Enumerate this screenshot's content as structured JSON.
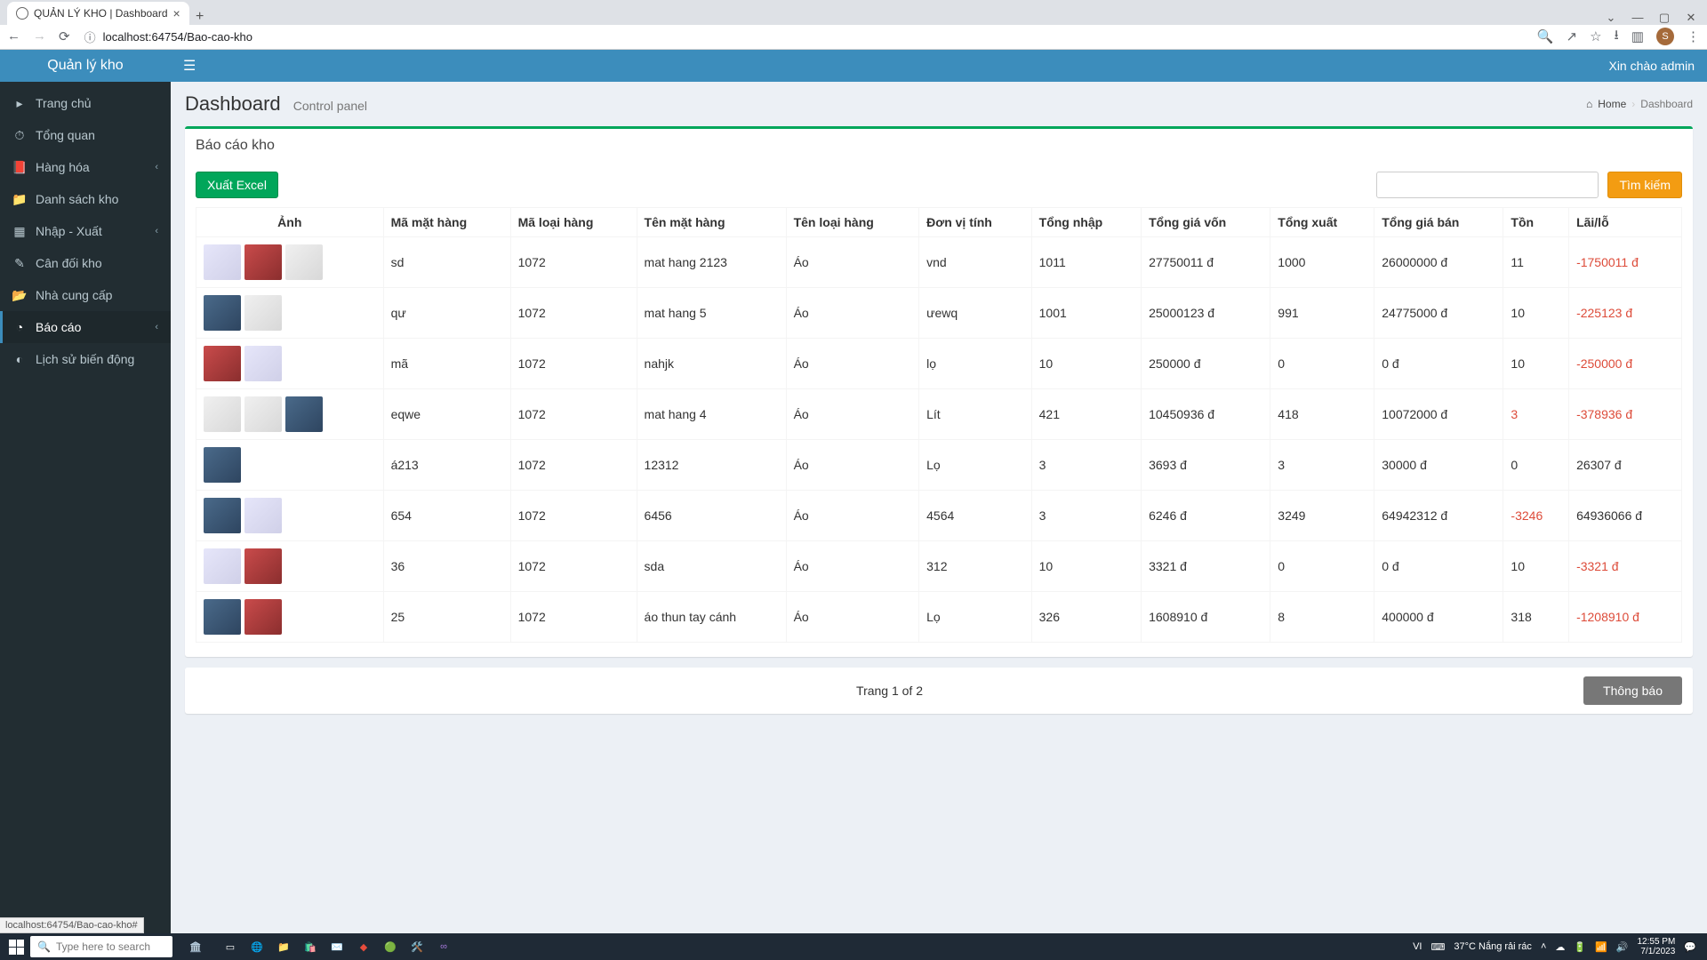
{
  "browser": {
    "tab_title": "QUẢN LÝ KHO | Dashboard",
    "url_info": "localhost:64754/Bao-cao-kho",
    "avatar_letter": "S"
  },
  "app": {
    "brand": "Quản lý kho",
    "greeting": "Xin chào admin"
  },
  "sidebar": {
    "items": [
      {
        "label": "Trang chủ",
        "has_sub": false,
        "active": false
      },
      {
        "label": "Tổng quan",
        "has_sub": false,
        "active": false
      },
      {
        "label": "Hàng hóa",
        "has_sub": true,
        "active": false
      },
      {
        "label": "Danh sách kho",
        "has_sub": false,
        "active": false
      },
      {
        "label": "Nhập - Xuất",
        "has_sub": true,
        "active": false
      },
      {
        "label": "Cân đối kho",
        "has_sub": false,
        "active": false
      },
      {
        "label": "Nhà cung cấp",
        "has_sub": false,
        "active": false
      },
      {
        "label": "Báo cáo",
        "has_sub": true,
        "active": true
      },
      {
        "label": "Lịch sử biến động",
        "has_sub": false,
        "active": false
      }
    ]
  },
  "header": {
    "title": "Dashboard",
    "subtitle": "Control panel",
    "breadcrumb_home": "Home",
    "breadcrumb_current": "Dashboard"
  },
  "box": {
    "title": "Báo cáo kho",
    "export_label": "Xuất Excel",
    "search_label": "Tìm kiếm"
  },
  "table": {
    "columns": [
      "Ảnh",
      "Mã mặt hàng",
      "Mã loại hàng",
      "Tên mặt hàng",
      "Tên loại hàng",
      "Đơn vị tính",
      "Tổng nhập",
      "Tổng giá vốn",
      "Tổng xuất",
      "Tổng giá bán",
      "Tồn",
      "Lãi/lỗ"
    ],
    "rows": [
      {
        "thumbs": [
          "p1",
          "p2",
          "p3"
        ],
        "ma_mh": "sd",
        "ma_lh": "1072",
        "ten_mh": "mat hang 2123",
        "ten_lh": "Áo",
        "dvt": "vnd",
        "tong_nhap": "1011",
        "gia_von": "27750011 đ",
        "tong_xuat": "1000",
        "gia_ban": "26000000 đ",
        "ton": "11",
        "ton_neg": false,
        "laiLo": "-1750011 đ",
        "neg": true
      },
      {
        "thumbs": [
          "p4",
          "p3"
        ],
        "ma_mh": "qư",
        "ma_lh": "1072",
        "ten_mh": "mat hang 5",
        "ten_lh": "Áo",
        "dvt": "ưewq",
        "tong_nhap": "1001",
        "gia_von": "25000123 đ",
        "tong_xuat": "991",
        "gia_ban": "24775000 đ",
        "ton": "10",
        "ton_neg": false,
        "laiLo": "-225123 đ",
        "neg": true
      },
      {
        "thumbs": [
          "p2",
          "p1"
        ],
        "ma_mh": "mã",
        "ma_lh": "1072",
        "ten_mh": "nahjk",
        "ten_lh": "Áo",
        "dvt": "lọ",
        "tong_nhap": "10",
        "gia_von": "250000 đ",
        "tong_xuat": "0",
        "gia_ban": "0 đ",
        "ton": "10",
        "ton_neg": false,
        "laiLo": "-250000 đ",
        "neg": true
      },
      {
        "thumbs": [
          "p3",
          "p3",
          "p4"
        ],
        "ma_mh": "eqwe",
        "ma_lh": "1072",
        "ten_mh": "mat hang 4",
        "ten_lh": "Áo",
        "dvt": "Lít",
        "tong_nhap": "421",
        "gia_von": "10450936 đ",
        "tong_xuat": "418",
        "gia_ban": "10072000 đ",
        "ton": "3",
        "ton_neg": true,
        "laiLo": "-378936 đ",
        "neg": true
      },
      {
        "thumbs": [
          "p4"
        ],
        "ma_mh": "á213",
        "ma_lh": "1072",
        "ten_mh": "12312",
        "ten_lh": "Áo",
        "dvt": "Lọ",
        "tong_nhap": "3",
        "gia_von": "3693 đ",
        "tong_xuat": "3",
        "gia_ban": "30000 đ",
        "ton": "0",
        "ton_neg": false,
        "laiLo": "26307 đ",
        "neg": false
      },
      {
        "thumbs": [
          "p4",
          "p1"
        ],
        "ma_mh": "654",
        "ma_lh": "1072",
        "ten_mh": "6456",
        "ten_lh": "Áo",
        "dvt": "4564",
        "tong_nhap": "3",
        "gia_von": "6246 đ",
        "tong_xuat": "3249",
        "gia_ban": "64942312 đ",
        "ton": "-3246",
        "ton_neg": true,
        "laiLo": "64936066 đ",
        "neg": false
      },
      {
        "thumbs": [
          "p1",
          "p2"
        ],
        "ma_mh": "36",
        "ma_lh": "1072",
        "ten_mh": "sda",
        "ten_lh": "Áo",
        "dvt": "312",
        "tong_nhap": "10",
        "gia_von": "3321 đ",
        "tong_xuat": "0",
        "gia_ban": "0 đ",
        "ton": "10",
        "ton_neg": false,
        "laiLo": "-3321 đ",
        "neg": true
      },
      {
        "thumbs": [
          "p4",
          "p2"
        ],
        "ma_mh": "25",
        "ma_lh": "1072",
        "ten_mh": "áo thun tay cánh",
        "ten_lh": "Áo",
        "dvt": "Lọ",
        "tong_nhap": "326",
        "gia_von": "1608910 đ",
        "tong_xuat": "8",
        "gia_ban": "400000 đ",
        "ton": "318",
        "ton_neg": false,
        "laiLo": "-1208910 đ",
        "neg": true
      }
    ]
  },
  "footer": {
    "pager": "Trang 1 of 2",
    "notify": "Thông báo"
  },
  "statusbar_link": "localhost:64754/Bao-cao-kho#",
  "taskbar": {
    "search_placeholder": "Type here to search",
    "lang": "VI",
    "weather": "37°C  Nắng rải rác",
    "time": "12:55 PM",
    "date": "7/1/2023"
  }
}
